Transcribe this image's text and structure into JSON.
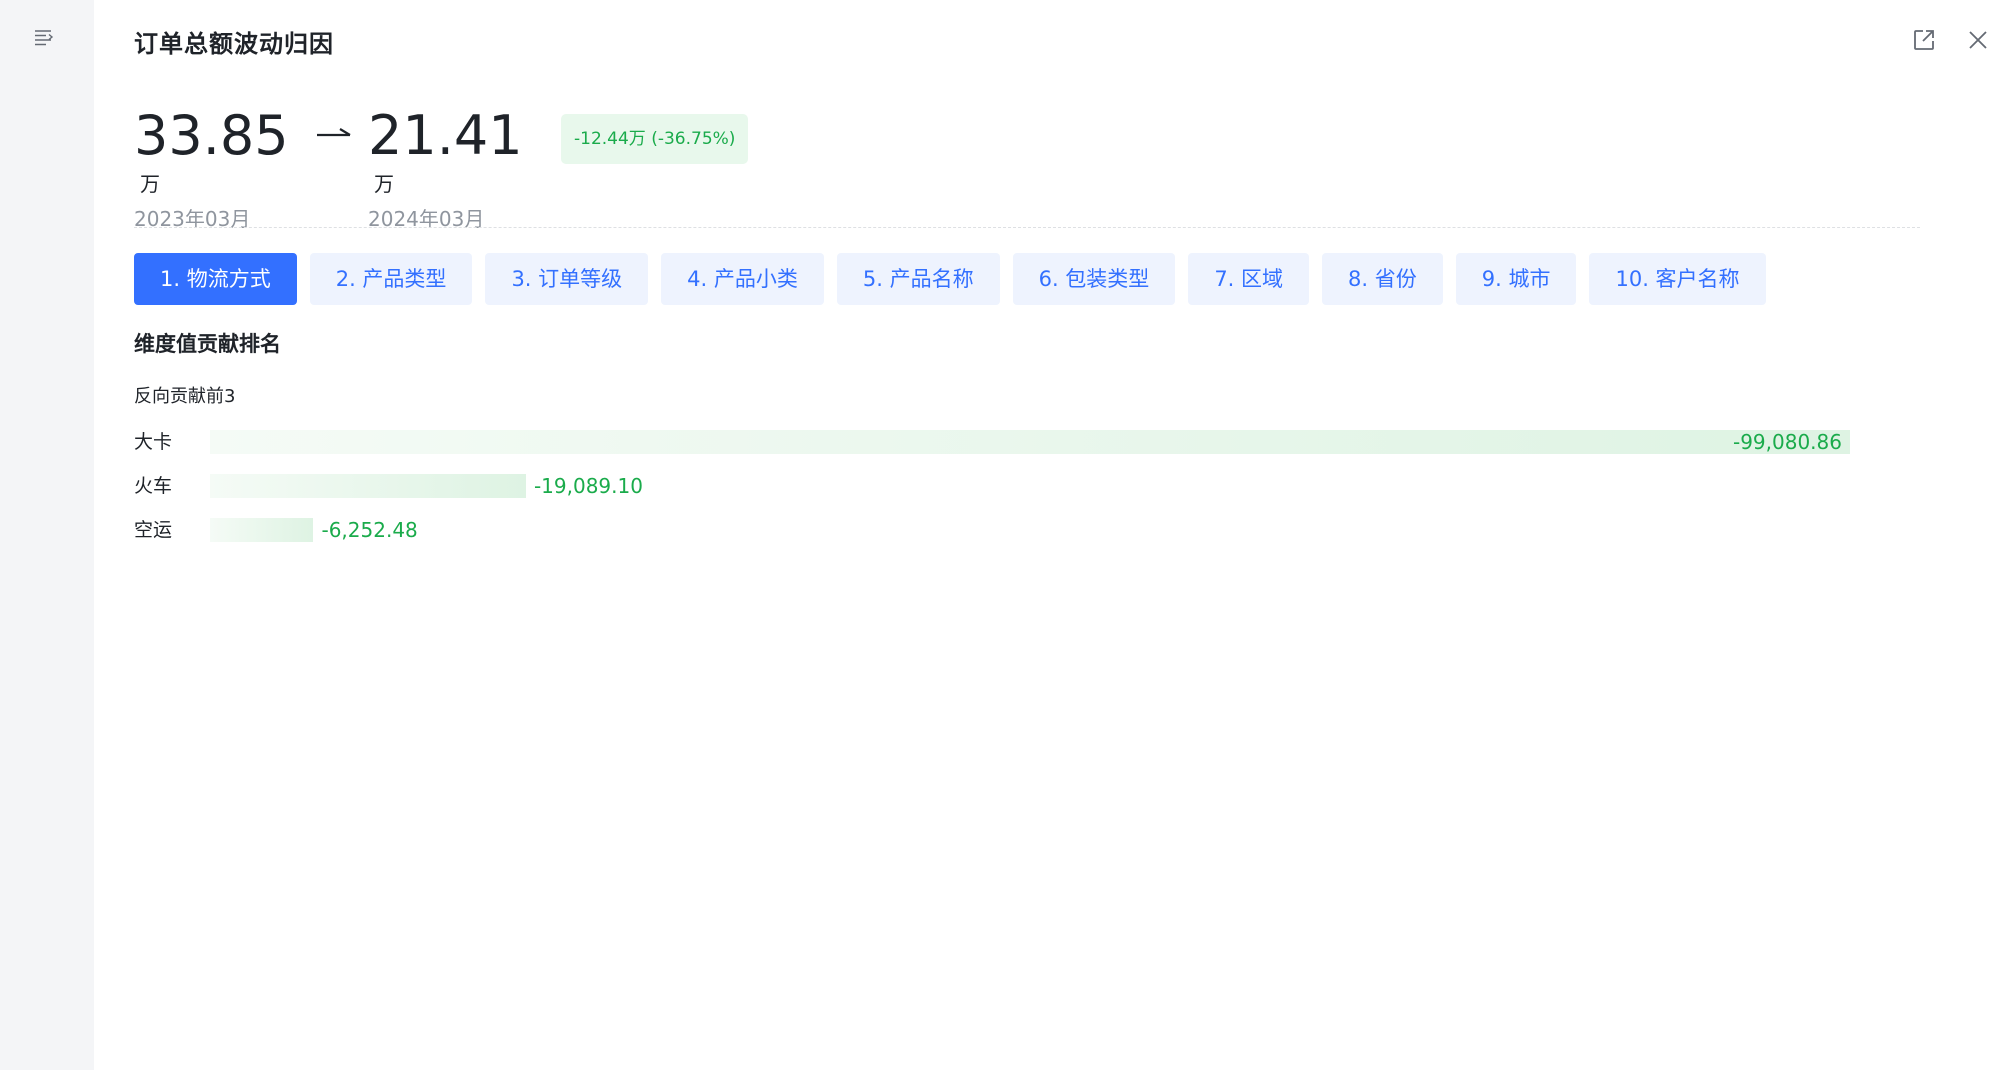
{
  "panel": {
    "title": "订单总额波动归因",
    "rail_icon": "menu-lines-icon",
    "actions": {
      "open_icon": "open-external-icon",
      "close_icon": "close-icon"
    }
  },
  "metric": {
    "from": {
      "value": "33.85",
      "unit": "万",
      "date": "2023年03月"
    },
    "arrow_icon": "arrow-right-icon",
    "to": {
      "value": "21.41",
      "unit": "万",
      "date": "2024年03月"
    },
    "delta": "-12.44万 (-36.75%)"
  },
  "tabs": [
    {
      "label": "1. 物流方式",
      "active": true
    },
    {
      "label": "2. 产品类型",
      "active": false
    },
    {
      "label": "3. 订单等级",
      "active": false
    },
    {
      "label": "4. 产品小类",
      "active": false
    },
    {
      "label": "5. 产品名称",
      "active": false
    },
    {
      "label": "6. 包装类型",
      "active": false
    },
    {
      "label": "7. 区域",
      "active": false
    },
    {
      "label": "8. 省份",
      "active": false
    },
    {
      "label": "9. 城市",
      "active": false
    },
    {
      "label": "10. 客户名称",
      "active": false
    }
  ],
  "section_title": "维度值贡献排名",
  "ranking_title": "反向贡献前3",
  "colors": {
    "accent": "#3370ff",
    "tab_bg": "#eef3fe",
    "negative_value": "#1aab4b",
    "badge_bg": "#e8f8ec"
  },
  "chart_data": {
    "type": "bar",
    "orientation": "horizontal",
    "categories": [
      "大卡",
      "火车",
      "空运"
    ],
    "values": [
      -99080.86,
      -19089.1,
      -6252.48
    ],
    "labels": [
      "-99,080.86",
      "-19,089.10",
      "-6,252.48"
    ]
  }
}
